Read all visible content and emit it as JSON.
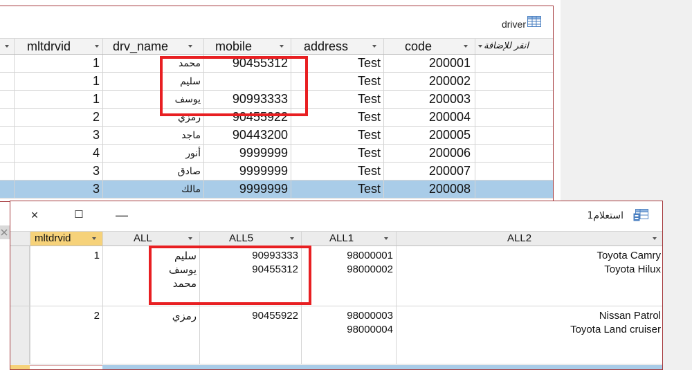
{
  "driver_table": {
    "title": "driver",
    "columns": [
      {
        "key": "mltdrvid",
        "label": "mltdrvid"
      },
      {
        "key": "drv_name",
        "label": "drv_name"
      },
      {
        "key": "mobile",
        "label": "mobile"
      },
      {
        "key": "address",
        "label": "address"
      },
      {
        "key": "code",
        "label": "code"
      },
      {
        "key": "add",
        "label": "انقر للإضافة"
      }
    ],
    "rows": [
      {
        "mltdrvid": "1",
        "drv_name": "محمد",
        "mobile": "90455312",
        "address": "Test",
        "code": "200001"
      },
      {
        "mltdrvid": "1",
        "drv_name": "سليم",
        "mobile": "",
        "address": "Test",
        "code": "200002"
      },
      {
        "mltdrvid": "1",
        "drv_name": "يوسف",
        "mobile": "90993333",
        "address": "Test",
        "code": "200003"
      },
      {
        "mltdrvid": "2",
        "drv_name": "رمزي",
        "mobile": "90455922",
        "address": "Test",
        "code": "200004"
      },
      {
        "mltdrvid": "3",
        "drv_name": "ماجد",
        "mobile": "90443200",
        "address": "Test",
        "code": "200005"
      },
      {
        "mltdrvid": "4",
        "drv_name": "أنور",
        "mobile": "9999999",
        "address": "Test",
        "code": "200006"
      },
      {
        "mltdrvid": "3",
        "drv_name": "صادق",
        "mobile": "9999999",
        "address": "Test",
        "code": "200007"
      },
      {
        "mltdrvid": "3",
        "drv_name": "مالك",
        "mobile": "9999999",
        "address": "Test",
        "code": "200008"
      }
    ],
    "selected_row": 7
  },
  "query_window": {
    "title": "استعلام1",
    "close_glyph": "×",
    "maximize_glyph": "☐",
    "minimize_glyph": "—",
    "columns": [
      {
        "key": "mltdrvid",
        "label": "mltdrvid"
      },
      {
        "key": "ALL",
        "label": "ALL"
      },
      {
        "key": "ALL5",
        "label": "ALL5"
      },
      {
        "key": "ALL1",
        "label": "ALL1"
      },
      {
        "key": "ALL2",
        "label": "ALL2"
      }
    ],
    "rows": [
      {
        "mltdrvid": "1",
        "ALL": [
          "سليم",
          "يوسف",
          "محمد"
        ],
        "ALL5": [
          "90993333",
          "90455312"
        ],
        "ALL1": [
          "98000001",
          "98000002"
        ],
        "ALL2": [
          "Toyota Camry",
          "Toyota Hilux"
        ]
      },
      {
        "mltdrvid": "2",
        "ALL": [
          "رمزي"
        ],
        "ALL5": [
          "90455922"
        ],
        "ALL1": [
          "98000003",
          "98000004"
        ],
        "ALL2": [
          "Nissan Patrol",
          "Toyota Land cruiser"
        ]
      }
    ]
  },
  "colors": {
    "window_border": "#a4373a",
    "highlight_box": "#e81f22",
    "selected_row": "#a9cce8",
    "header_selected": "#f6d27a"
  }
}
